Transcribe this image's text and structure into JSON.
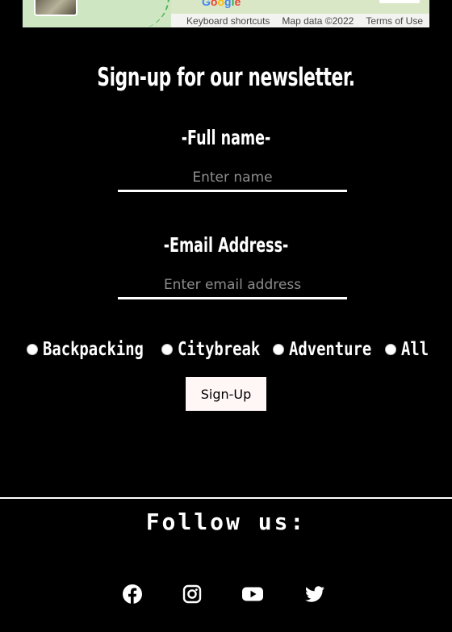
{
  "map": {
    "logo_letters": [
      "G",
      "o",
      "o",
      "g",
      "l",
      "e"
    ],
    "keyboard_shortcuts": "Keyboard shortcuts",
    "map_data": "Map data ©2022",
    "terms": "Terms of Use"
  },
  "newsletter": {
    "title": "Sign-up for our newsletter.",
    "name_label": "-Full name-",
    "name_placeholder": "Enter name",
    "email_label": "-Email Address-",
    "email_placeholder": "Enter email address",
    "options": [
      "Backpacking",
      "Citybreak",
      "Adventure",
      "All"
    ],
    "submit_label": "Sign-Up"
  },
  "footer": {
    "follow_label": "Follow us:",
    "socials": [
      "facebook-icon",
      "instagram-icon",
      "youtube-icon",
      "twitter-icon"
    ]
  },
  "colors": {
    "background": "#000000",
    "text": "#ffffff",
    "button_bg": "#fff6f6",
    "placeholder": "#8d8d8d"
  }
}
